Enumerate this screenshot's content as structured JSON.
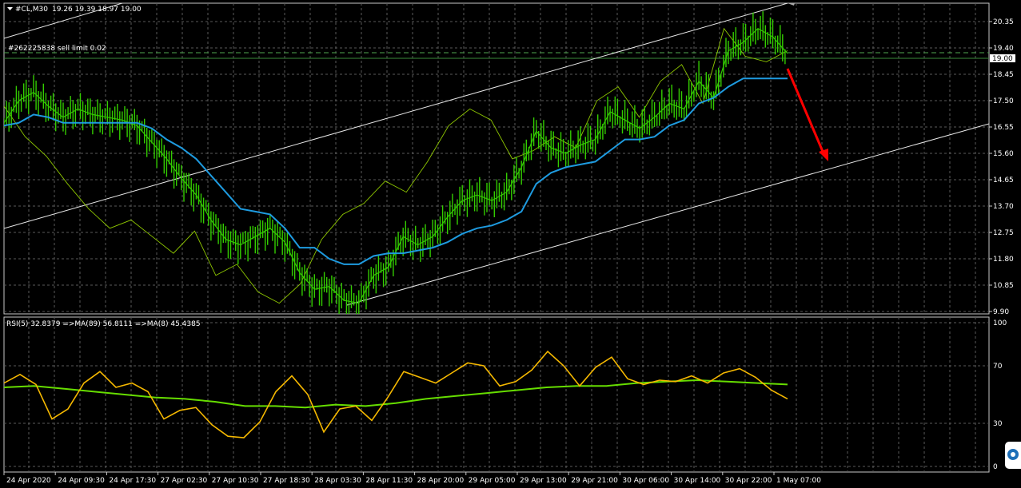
{
  "header": {
    "symbol": "#CL,M30",
    "ohlc": "19.26 19.39 18.97 19.00",
    "menu_icon": "triangle-down-icon"
  },
  "order_line": {
    "label": "#262225838 sell limit 0.02"
  },
  "price_axis": {
    "ticks": [
      "20.35",
      "19.40",
      "18.45",
      "17.50",
      "16.55",
      "15.60",
      "14.65",
      "13.70",
      "12.75",
      "11.80",
      "10.85",
      "9.90"
    ],
    "current_price": "19.00"
  },
  "rsi_panel": {
    "header": "RSI(5) 32.8379  =>MA(89) 56.8111  =>MA(8) 45.4385",
    "ticks": [
      "100",
      "70",
      "30",
      "0"
    ]
  },
  "time_axis": {
    "labels": [
      "24 Apr 2020",
      "24 Apr 09:30",
      "24 Apr 17:30",
      "27 Apr 02:30",
      "27 Apr 10:30",
      "27 Apr 18:30",
      "28 Apr 03:30",
      "28 Apr 11:30",
      "28 Apr 20:00",
      "29 Apr 05:00",
      "29 Apr 13:00",
      "29 Apr 21:00",
      "30 Apr 06:00",
      "30 Apr 14:00",
      "30 Apr 22:00",
      "1 May 07:00"
    ]
  },
  "colors": {
    "background": "#000000",
    "grid": "#5a5a5a",
    "price_series": "#33cc00",
    "ma_blue": "#1e9be0",
    "thin_line": "#8fc800",
    "channel": "#e8e8e8",
    "arrow": "#ff0000",
    "rsi": "#f5b800",
    "rsi_ma": "#66dd00",
    "order_line": "#4fa84f"
  },
  "side_badge": {
    "icon": "remote-support-icon"
  },
  "chart_data": {
    "type": "line",
    "series": [],
    "price_ylim": [
      9.9,
      20.9
    ],
    "rsi_ylim": [
      0,
      100
    ],
    "price_series": [
      16.7,
      17.5,
      17.8,
      17.3,
      16.9,
      17.2,
      17.0,
      16.9,
      16.8,
      16.6,
      16.0,
      15.4,
      14.7,
      14.1,
      13.2,
      12.5,
      12.3,
      12.6,
      12.9,
      12.4,
      11.3,
      10.7,
      10.8,
      10.3,
      10.2,
      11.2,
      11.5,
      12.6,
      12.3,
      12.6,
      13.3,
      13.9,
      14.1,
      13.9,
      14.2,
      15.1,
      16.4,
      15.8,
      15.6,
      15.9,
      16.1,
      17.1,
      16.8,
      16.5,
      16.9,
      17.4,
      17.2,
      18.2,
      17.6,
      19.3,
      19.6,
      20.1,
      19.8,
      19.2
    ],
    "ma_blue": [
      16.6,
      16.7,
      17.0,
      16.9,
      16.7,
      16.7,
      16.7,
      16.7,
      16.7,
      16.7,
      16.5,
      16.1,
      15.8,
      15.4,
      14.8,
      14.2,
      13.6,
      13.5,
      13.4,
      12.9,
      12.2,
      12.2,
      11.8,
      11.6,
      11.6,
      11.9,
      12.0,
      12.0,
      12.1,
      12.2,
      12.4,
      12.7,
      12.9,
      13.0,
      13.2,
      13.5,
      14.5,
      14.9,
      15.1,
      15.2,
      15.3,
      15.7,
      16.1,
      16.1,
      16.2,
      16.6,
      16.8,
      17.4,
      17.6,
      18.0,
      18.3,
      18.3,
      18.3,
      18.3
    ],
    "thin_line": [
      17.3,
      16.2,
      15.5,
      14.5,
      13.6,
      12.9,
      13.2,
      12.6,
      12.0,
      12.8,
      11.2,
      11.6,
      10.6,
      10.2,
      10.9,
      12.5,
      13.4,
      13.8,
      14.6,
      14.2,
      15.3,
      16.6,
      17.2,
      16.8,
      15.4,
      15.7,
      16.2,
      15.8,
      17.5,
      18.0,
      16.9,
      18.2,
      18.8,
      17.4,
      20.1,
      19.1,
      18.9,
      19.3
    ],
    "rsi": [
      58,
      64,
      57,
      33,
      40,
      58,
      66,
      55,
      58,
      52,
      33,
      39,
      41,
      29,
      21,
      20,
      31,
      52,
      63,
      50,
      24,
      40,
      42,
      32,
      48,
      66,
      62,
      58,
      65,
      72,
      70,
      56,
      59,
      67,
      80,
      70,
      56,
      69,
      76,
      61,
      57,
      60,
      59,
      63,
      58,
      65,
      68,
      62,
      53,
      47
    ],
    "rsi_ma": [
      55,
      56,
      54,
      52,
      50,
      48,
      47,
      45,
      42,
      42,
      41,
      43,
      42,
      44,
      47,
      49,
      51,
      53,
      55,
      56,
      56,
      58,
      59,
      60,
      59,
      58,
      57
    ]
  }
}
